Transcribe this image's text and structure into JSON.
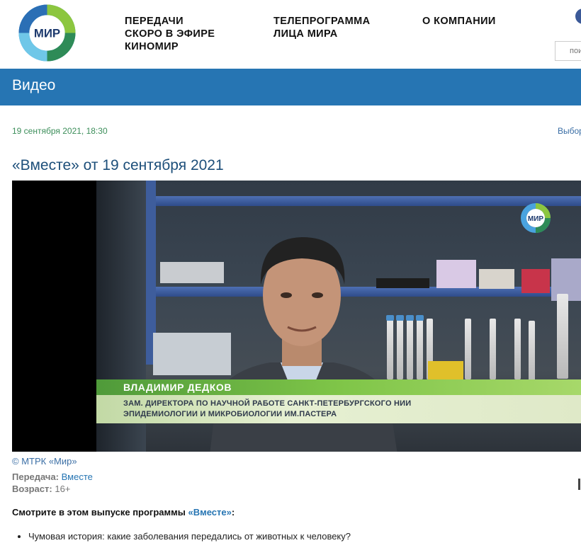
{
  "header": {
    "logo_text": "МИР",
    "nav_col1": [
      "ПЕРЕДАЧИ",
      "СКОРО В ЭФИРЕ",
      "КИНОМИР"
    ],
    "nav_col2": [
      "ТЕЛЕПРОГРАММА",
      "ЛИЦА МИРА"
    ],
    "nav_col3": [
      "О КОМПАНИИ"
    ],
    "search_placeholder": "пои"
  },
  "band": {
    "title": "Видео"
  },
  "article": {
    "date": "19 сентября 2021, 18:30",
    "select_link": "Выбор",
    "title": "«Вместе» от 19 сентября 2021",
    "copyright": "© МТРК «Мир»",
    "show_label": "Передача:",
    "show_value": "Вместе",
    "age_label": "Возраст:",
    "age_value": "16+",
    "watch_prefix": "Смотрите в этом выпуске программы ",
    "watch_link": "«Вместе»",
    "watch_suffix": ":",
    "bullets": [
      "Чумовая история: какие заболевания передались от животных к человеку?"
    ]
  },
  "video": {
    "channel_logo": "МИР",
    "lower_third_name": "ВЛАДИМИР ДЕДКОВ",
    "lower_third_line1": "ЗАМ. ДИРЕКТОРА ПО НАУЧНОЙ РАБОТЕ САНКТ-ПЕТЕРБУРГСКОГО НИИ",
    "lower_third_line2": "ЭПИДЕМИОЛОГИИ И МИКРОБИОЛОГИИ ИМ.ПАСТЕРА"
  },
  "colors": {
    "brand_blue": "#2675b3",
    "date_green": "#3c8e5a"
  }
}
